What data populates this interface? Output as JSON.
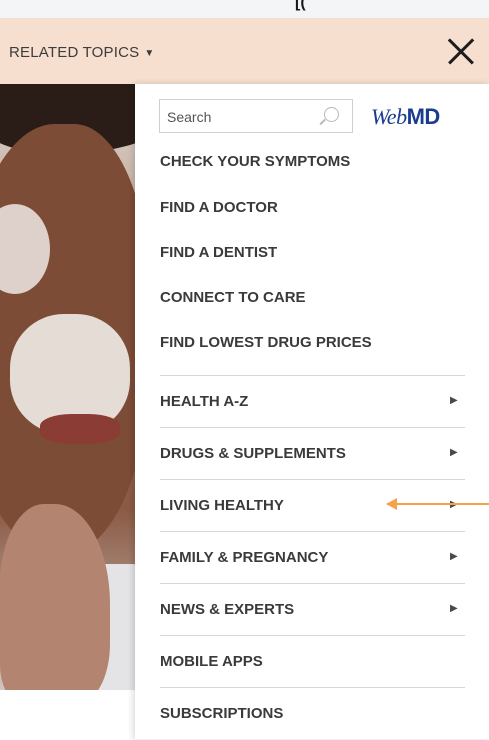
{
  "header": {
    "related_label": "RELATED TOPICS",
    "caret_icon": "▼",
    "top_glyph": "[("
  },
  "search": {
    "placeholder": "Search"
  },
  "logo": {
    "web": "Web",
    "md": "MD"
  },
  "quick_links": [
    "CHECK YOUR SYMPTOMS",
    "FIND A DOCTOR",
    "FIND A DENTIST",
    "CONNECT TO CARE",
    "FIND LOWEST DRUG PRICES"
  ],
  "sections": [
    {
      "label": "HEALTH A-Z",
      "chevron": "▶"
    },
    {
      "label": "DRUGS & SUPPLEMENTS",
      "chevron": "▶"
    },
    {
      "label": "LIVING HEALTHY",
      "chevron": "▶"
    },
    {
      "label": "FAMILY & PREGNANCY",
      "chevron": "▶"
    },
    {
      "label": "NEWS & EXPERTS",
      "chevron": "▶"
    },
    {
      "label": "MOBILE APPS",
      "chevron": ""
    },
    {
      "label": "SUBSCRIPTIONS",
      "chevron": ""
    }
  ],
  "colors": {
    "header_bg": "#f6dfcf",
    "logo_blue": "#1b3d8f",
    "annotation_arrow": "#f5a24a"
  }
}
